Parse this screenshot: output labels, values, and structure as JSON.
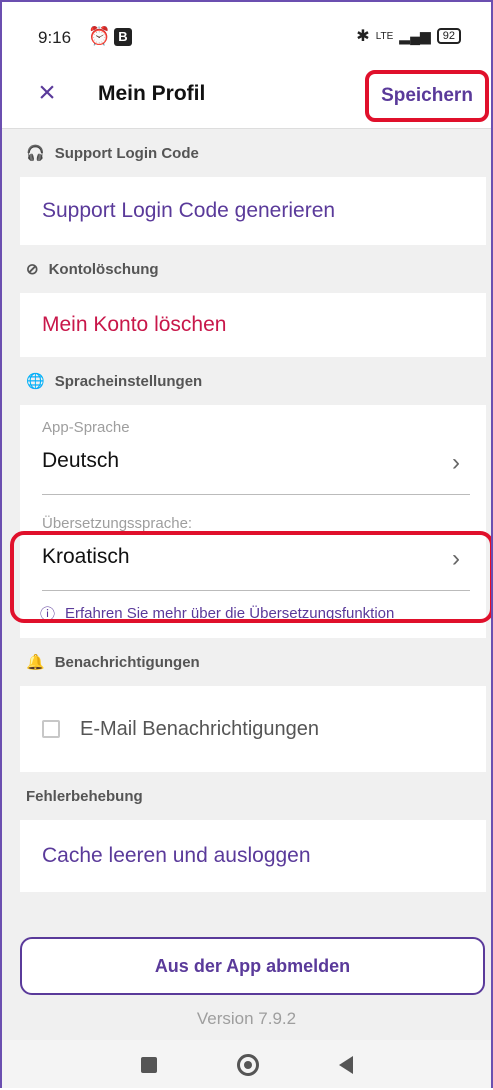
{
  "status_bar": {
    "time": "9:16",
    "battery": "92",
    "network": "LTE"
  },
  "header": {
    "title": "Mein Profil",
    "save_label": "Speichern"
  },
  "sections": {
    "support": {
      "header": "Support Login Code",
      "action": "Support Login Code generieren"
    },
    "account_deletion": {
      "header": "Kontolöschung",
      "action": "Mein Konto löschen"
    },
    "language": {
      "header": "Spracheinstellungen",
      "app_language_label": "App-Sprache",
      "app_language_value": "Deutsch",
      "translation_label": "Übersetzungssprache:",
      "translation_value": "Kroatisch",
      "info_link": "Erfahren Sie mehr über die Übersetzungsfunktion"
    },
    "notifications": {
      "header": "Benachrichtigungen",
      "email_label": "E-Mail Benachrichtigungen",
      "email_checked": false
    },
    "troubleshooting": {
      "header": "Fehlerbehebung",
      "action": "Cache leeren und ausloggen"
    }
  },
  "footer": {
    "signout_label": "Aus der App abmelden",
    "version": "Version 7.9.2"
  },
  "colors": {
    "accent": "#5a3a9a",
    "danger": "#c8174a",
    "highlight": "#e0102b"
  }
}
